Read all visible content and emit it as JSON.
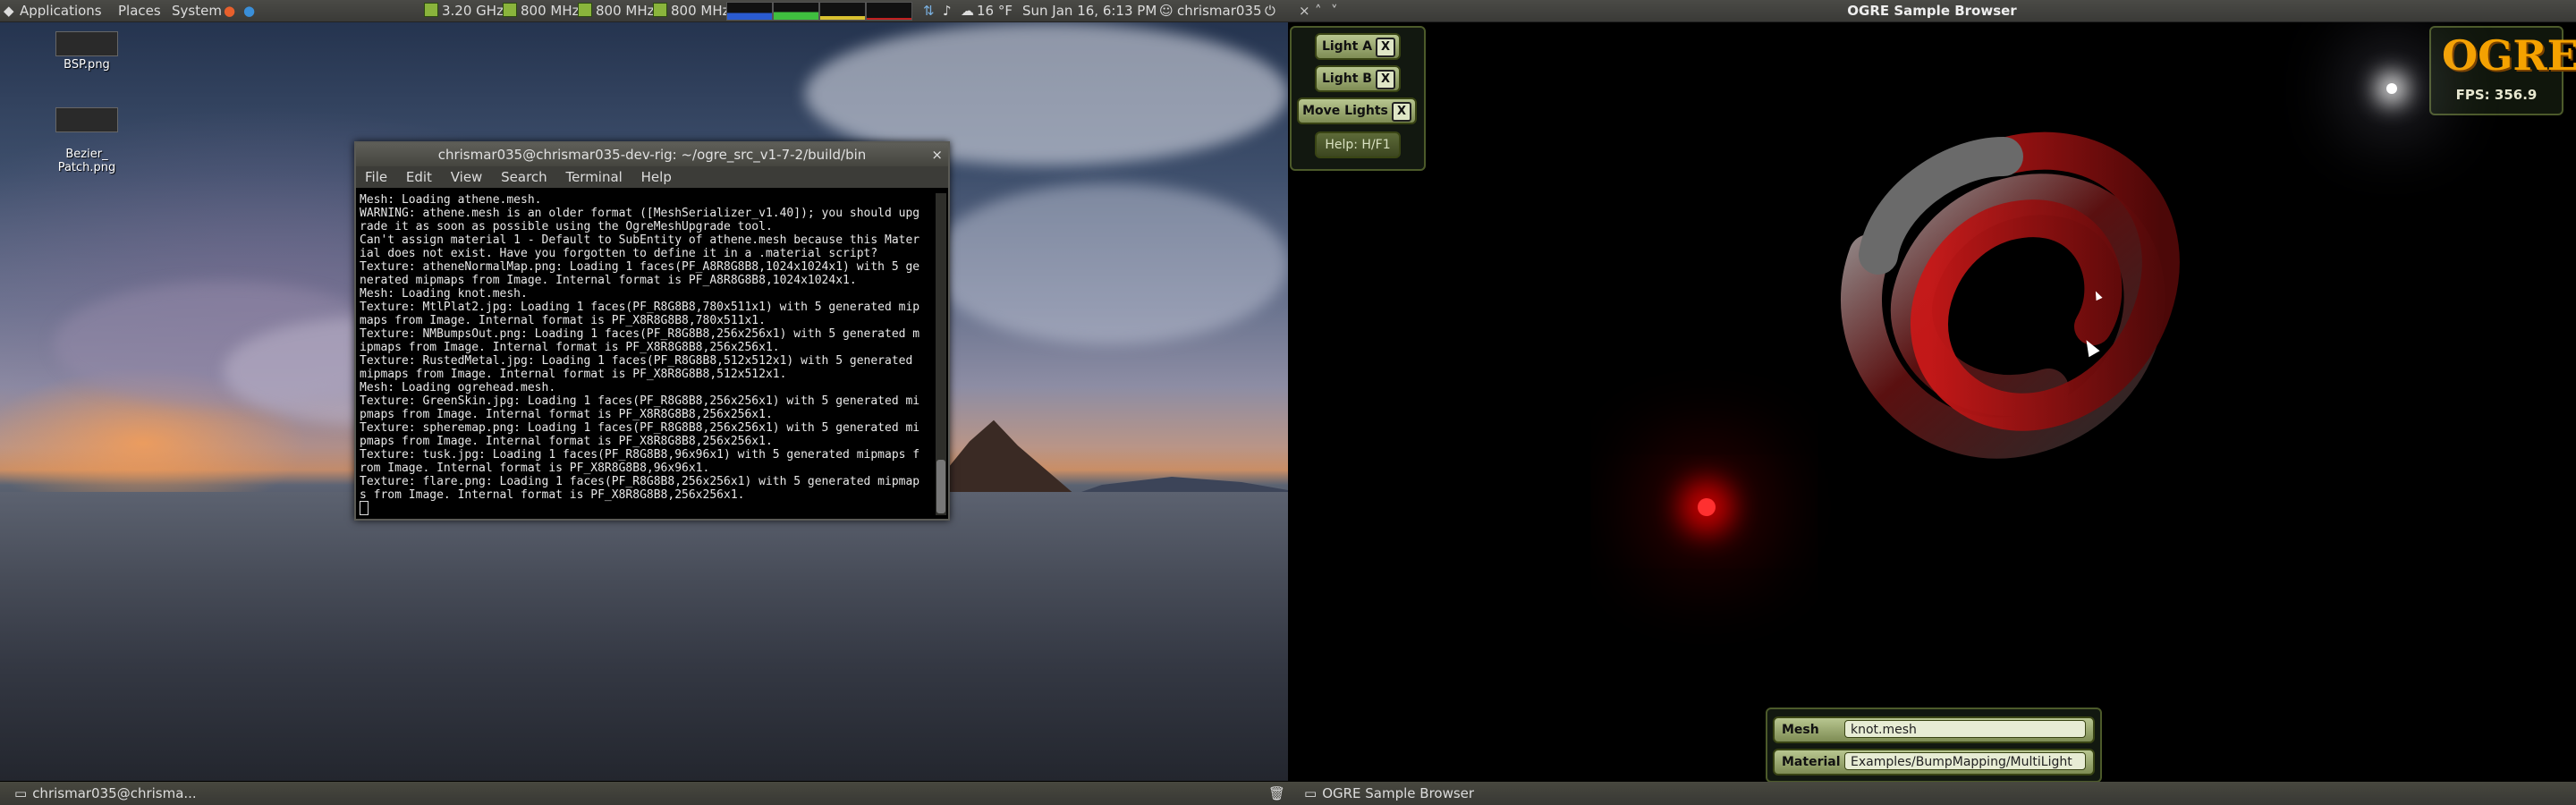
{
  "top_panel": {
    "menus": [
      "Applications",
      "Places",
      "System"
    ],
    "cpu_freqs": [
      "3.20 GHz",
      "800 MHz",
      "800 MHz",
      "800 MHz"
    ],
    "weather": "16 °F",
    "datetime": "Sun Jan 16,  6:13 PM",
    "user": "chrismar035"
  },
  "desktop": {
    "icons": [
      {
        "label": "BSP.png"
      },
      {
        "label": "Bezier_\nPatch.png"
      }
    ]
  },
  "terminal": {
    "title": "chrismar035@chrismar035-dev-rig: ~/ogre_src_v1-7-2/build/bin",
    "menu": [
      "File",
      "Edit",
      "View",
      "Search",
      "Terminal",
      "Help"
    ],
    "output": "Mesh: Loading athene.mesh.\nWARNING: athene.mesh is an older format ([MeshSerializer_v1.40]); you should upg\nrade it as soon as possible using the OgreMeshUpgrade tool.\nCan't assign material 1 - Default to SubEntity of athene.mesh because this Mater\nial does not exist. Have you forgotten to define it in a .material script?\nTexture: atheneNormalMap.png: Loading 1 faces(PF_A8R8G8B8,1024x1024x1) with 5 ge\nnerated mipmaps from Image. Internal format is PF_A8R8G8B8,1024x1024x1.\nMesh: Loading knot.mesh.\nTexture: MtlPlat2.jpg: Loading 1 faces(PF_R8G8B8,780x511x1) with 5 generated mip\nmaps from Image. Internal format is PF_X8R8G8B8,780x511x1.\nTexture: NMBumpsOut.png: Loading 1 faces(PF_R8G8B8,256x256x1) with 5 generated m\nipmaps from Image. Internal format is PF_X8R8G8B8,256x256x1.\nTexture: RustedMetal.jpg: Loading 1 faces(PF_R8G8B8,512x512x1) with 5 generated \nmipmaps from Image. Internal format is PF_X8R8G8B8,512x512x1.\nMesh: Loading ogrehead.mesh.\nTexture: GreenSkin.jpg: Loading 1 faces(PF_R8G8B8,256x256x1) with 5 generated mi\npmaps from Image. Internal format is PF_X8R8G8B8,256x256x1.\nTexture: spheremap.png: Loading 1 faces(PF_R8G8B8,256x256x1) with 5 generated mi\npmaps from Image. Internal format is PF_X8R8G8B8,256x256x1.\nTexture: tusk.jpg: Loading 1 faces(PF_R8G8B8,96x96x1) with 5 generated mipmaps f\nrom Image. Internal format is PF_X8R8G8B8,96x96x1.\nTexture: flare.png: Loading 1 faces(PF_R8G8B8,256x256x1) with 5 generated mipmap\ns from Image. Internal format is PF_X8R8G8B8,256x256x1."
  },
  "bottom_panel": {
    "tasks": [
      "chrismar035@chrisma...",
      "OGRE Sample Browser"
    ]
  },
  "ogre": {
    "window_title": "OGRE Sample Browser",
    "controls": {
      "light_a": "Light A",
      "light_b": "Light B",
      "move_lights": "Move Lights",
      "close_x": "X",
      "help": "Help: H/F1"
    },
    "logo_text": "OGRE",
    "fps": "FPS: 356.9",
    "params": [
      {
        "label": "Mesh",
        "value": "knot.mesh"
      },
      {
        "label": "Material",
        "value": "Examples/BumpMapping/MultiLight"
      }
    ],
    "colors": {
      "accent": "#f5a200",
      "tray_border": "#4c5a2a",
      "button": "#9aa870"
    }
  }
}
